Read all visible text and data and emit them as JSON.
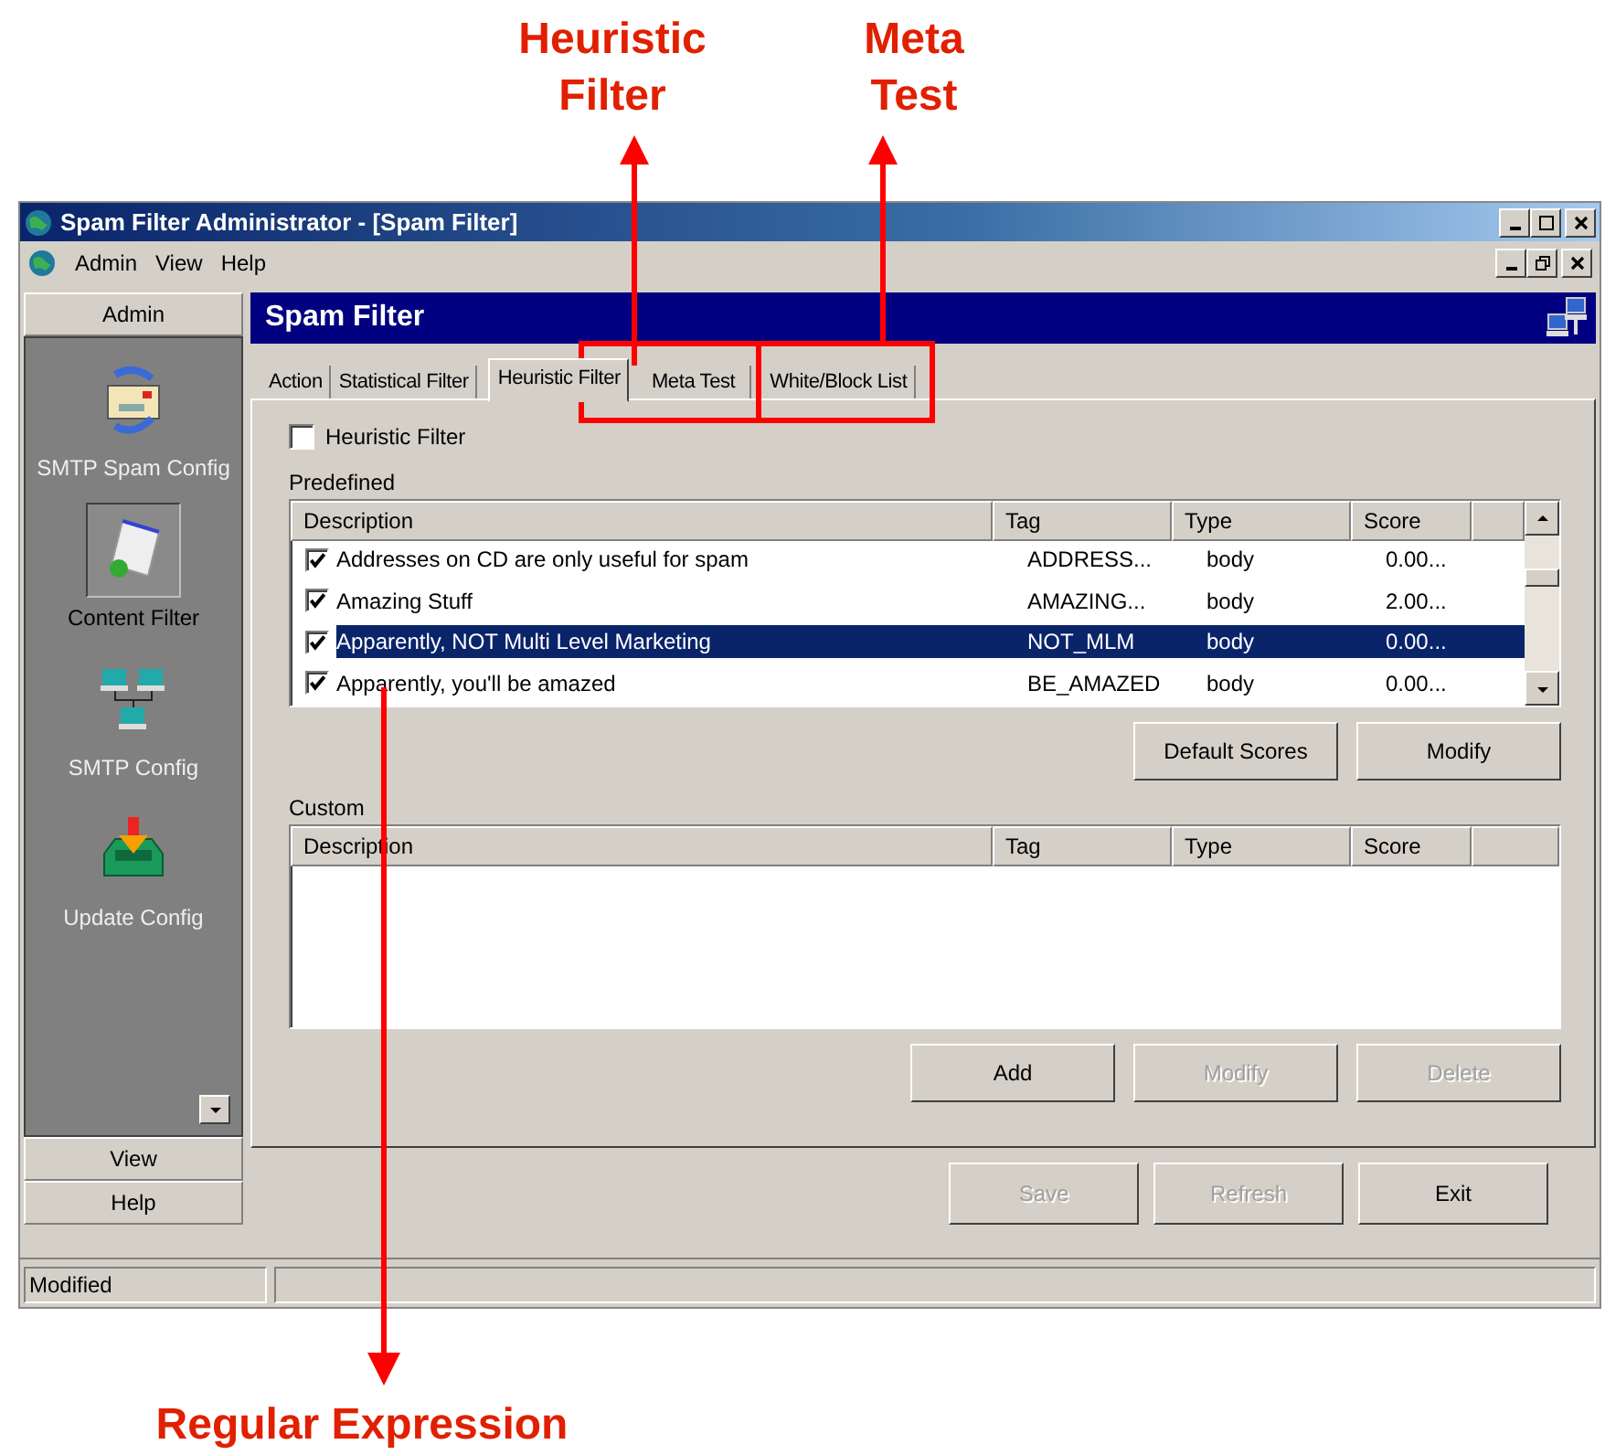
{
  "window": {
    "title": "Spam Filter Administrator - [Spam Filter]"
  },
  "menu": [
    "Admin",
    "View",
    "Help"
  ],
  "sidebar": {
    "header": "Admin",
    "items": [
      {
        "label": "SMTP Spam Config",
        "kind": "envelope",
        "selected": false
      },
      {
        "label": "Content Filter",
        "kind": "document",
        "selected": true
      },
      {
        "label": "SMTP Config",
        "kind": "network",
        "selected": false
      },
      {
        "label": "Update Config",
        "kind": "inbox",
        "selected": false
      }
    ],
    "footer": [
      "View",
      "Help"
    ]
  },
  "panel": {
    "title": "Spam Filter"
  },
  "tabs": [
    {
      "label": "Action",
      "selected": false
    },
    {
      "label": "Statistical Filter",
      "selected": false
    },
    {
      "label": "Heuristic Filter",
      "selected": true
    },
    {
      "label": "Meta Test",
      "selected": false
    },
    {
      "label": "White/Block List",
      "selected": false
    }
  ],
  "enable": {
    "label": "Heuristic Filter",
    "checked": false
  },
  "predefined": {
    "label": "Predefined",
    "columns": [
      "Description",
      "Tag",
      "Type",
      "Score"
    ],
    "rows": [
      {
        "checked": true,
        "selected": false,
        "cells": [
          "Addresses on CD are only useful for spam",
          "ADDRESS...",
          "body",
          "0.00..."
        ]
      },
      {
        "checked": true,
        "selected": false,
        "cells": [
          "Amazing Stuff",
          "AMAZING...",
          "body",
          "2.00..."
        ]
      },
      {
        "checked": true,
        "selected": true,
        "cells": [
          "Apparently, NOT Multi Level Marketing",
          "NOT_MLM",
          "body",
          "0.00..."
        ]
      },
      {
        "checked": true,
        "selected": false,
        "cells": [
          "Apparently, you'll be amazed",
          "BE_AMAZED",
          "body",
          "0.00..."
        ]
      }
    ],
    "buttons": [
      {
        "label": "Default Scores",
        "disabled": false
      },
      {
        "label": "Modify",
        "disabled": false
      }
    ]
  },
  "custom": {
    "label": "Custom",
    "columns": [
      "Description",
      "Tag",
      "Type",
      "Score"
    ],
    "buttons": [
      {
        "label": "Add",
        "disabled": false
      },
      {
        "label": "Modify",
        "disabled": true
      },
      {
        "label": "Delete",
        "disabled": true
      }
    ]
  },
  "footer_buttons": [
    {
      "label": "Save",
      "disabled": true
    },
    {
      "label": "Refresh",
      "disabled": true
    },
    {
      "label": "Exit",
      "disabled": false
    }
  ],
  "status_bar": [
    "Modified"
  ],
  "callouts": [
    {
      "label": "Heuristic Filter",
      "kind": "tab"
    },
    {
      "label": "Meta Test",
      "kind": "tab"
    },
    {
      "label": "Regular Expression",
      "kind": "row"
    }
  ]
}
